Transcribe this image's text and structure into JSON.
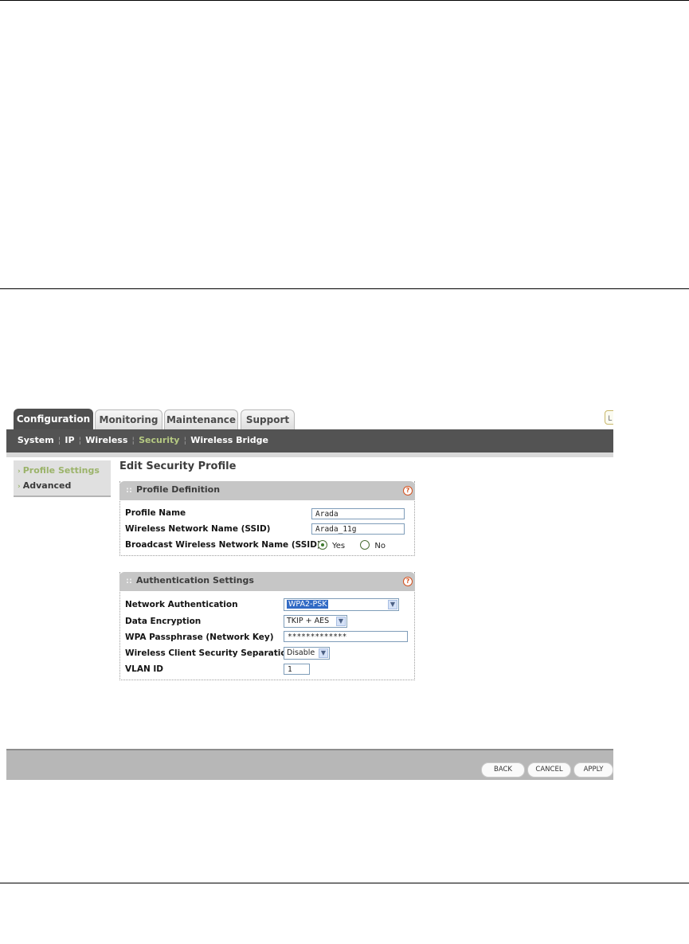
{
  "tabs": [
    {
      "label": "Configuration",
      "active": true
    },
    {
      "label": "Monitoring",
      "active": false
    },
    {
      "label": "Maintenance",
      "active": false
    },
    {
      "label": "Support",
      "active": false
    }
  ],
  "corner_button": {
    "label": "L"
  },
  "subnav": {
    "items": [
      "System",
      "IP",
      "Wireless",
      "Security",
      "Wireless Bridge"
    ],
    "active": "Security"
  },
  "sidebar": {
    "items": [
      {
        "label": "Profile Settings",
        "active": true
      },
      {
        "label": "Advanced",
        "active": false
      }
    ]
  },
  "page_title": "Edit Security Profile",
  "profile_definition": {
    "title": "Profile Definition",
    "profile_name_label": "Profile Name",
    "profile_name_value": "Arada",
    "ssid_label": "Wireless Network Name (SSID)",
    "ssid_value": "Arada_11g",
    "broadcast_label": "Broadcast Wireless Network Name (SSID)",
    "broadcast_options": [
      "Yes",
      "No"
    ],
    "broadcast_selected": "Yes"
  },
  "authentication_settings": {
    "title": "Authentication Settings",
    "network_auth_label": "Network Authentication",
    "network_auth_value": "WPA2-PSK",
    "data_encryption_label": "Data Encryption",
    "data_encryption_value": "TKIP + AES",
    "passphrase_label": "WPA Passphrase (Network Key)",
    "passphrase_value": "*************",
    "client_separation_label": "Wireless Client Security Separation",
    "client_separation_value": "Disable",
    "vlan_label": "VLAN ID",
    "vlan_value": "1"
  },
  "help_icon": "?",
  "footer_buttons": [
    "BACK",
    "CANCEL",
    "APPLY"
  ],
  "colors": {
    "active_tab": "#4f4f4f",
    "subnav_bg": "#535353",
    "subnav_active": "#b5c982",
    "sidebar_active": "#9bb36a",
    "help_icon": "#d4501d"
  }
}
